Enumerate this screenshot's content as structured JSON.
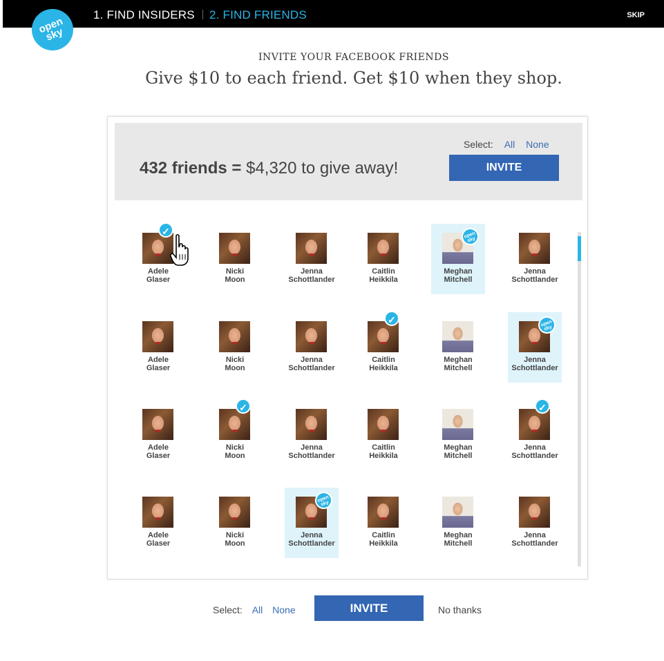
{
  "header": {
    "step1": "1. FIND INSIDERS",
    "step2": "2. FIND FRIENDS",
    "skip": "SKIP"
  },
  "logo": {
    "line1": "open",
    "line2": "sky"
  },
  "intro": {
    "eyebrow": "INVITE YOUR FACEBOOK FRIENDS",
    "headline": "Give $10 to each friend. Get $10 when they shop."
  },
  "banner": {
    "count": "432 friends",
    "equals": "=",
    "amount": "$4,320 to give away!",
    "select_label": "Select:",
    "select_all": "All",
    "select_none": "None",
    "invite": "INVITE"
  },
  "friends": [
    {
      "first": "Adele",
      "last": "Glaser",
      "type": "female",
      "checked": true,
      "opensky": false
    },
    {
      "first": "Nicki",
      "last": "Moon",
      "type": "female",
      "checked": false,
      "opensky": false
    },
    {
      "first": "Jenna",
      "last": "Schottlander",
      "type": "female",
      "checked": false,
      "opensky": false
    },
    {
      "first": "Caitlin",
      "last": "Heikkila",
      "type": "female",
      "checked": false,
      "opensky": false
    },
    {
      "first": "Meghan",
      "last": "Mitchell",
      "type": "male",
      "checked": false,
      "opensky": true
    },
    {
      "first": "Jenna",
      "last": "Schottlander",
      "type": "female",
      "checked": false,
      "opensky": false
    },
    {
      "first": "Adele",
      "last": "Glaser",
      "type": "female",
      "checked": false,
      "opensky": false
    },
    {
      "first": "Nicki",
      "last": "Moon",
      "type": "female",
      "checked": false,
      "opensky": false
    },
    {
      "first": "Jenna",
      "last": "Schottlander",
      "type": "female",
      "checked": false,
      "opensky": false
    },
    {
      "first": "Caitlin",
      "last": "Heikkila",
      "type": "female",
      "checked": true,
      "opensky": false
    },
    {
      "first": "Meghan",
      "last": "Mitchell",
      "type": "male",
      "checked": false,
      "opensky": false
    },
    {
      "first": "Jenna",
      "last": "Schottlander",
      "type": "female",
      "checked": false,
      "opensky": true
    },
    {
      "first": "Adele",
      "last": "Glaser",
      "type": "female",
      "checked": false,
      "opensky": false
    },
    {
      "first": "Nicki",
      "last": "Moon",
      "type": "female",
      "checked": true,
      "opensky": false
    },
    {
      "first": "Jenna",
      "last": "Schottlander",
      "type": "female",
      "checked": false,
      "opensky": false
    },
    {
      "first": "Caitlin",
      "last": "Heikkila",
      "type": "female",
      "checked": false,
      "opensky": false
    },
    {
      "first": "Meghan",
      "last": "Mitchell",
      "type": "male",
      "checked": false,
      "opensky": false
    },
    {
      "first": "Jenna",
      "last": "Schottlander",
      "type": "female",
      "checked": true,
      "opensky": false
    },
    {
      "first": "Adele",
      "last": "Glaser",
      "type": "female",
      "checked": false,
      "opensky": false
    },
    {
      "first": "Nicki",
      "last": "Moon",
      "type": "female",
      "checked": false,
      "opensky": false
    },
    {
      "first": "Jenna",
      "last": "Schottlander",
      "type": "female",
      "checked": false,
      "opensky": true
    },
    {
      "first": "Caitlin",
      "last": "Heikkila",
      "type": "female",
      "checked": false,
      "opensky": false
    },
    {
      "first": "Meghan",
      "last": "Mitchell",
      "type": "male",
      "checked": false,
      "opensky": false
    },
    {
      "first": "Jenna",
      "last": "Schottlander",
      "type": "female",
      "checked": false,
      "opensky": false
    }
  ],
  "badge": {
    "line1": "open",
    "line2": "sky"
  },
  "bottom": {
    "select_label": "Select:",
    "select_all": "All",
    "select_none": "None",
    "invite": "INVITE",
    "no_thanks": "No thanks"
  },
  "colors": {
    "accent": "#2bb5e6",
    "button": "#3366b3",
    "link": "#3a6db5",
    "highlight": "#dff3fb"
  }
}
